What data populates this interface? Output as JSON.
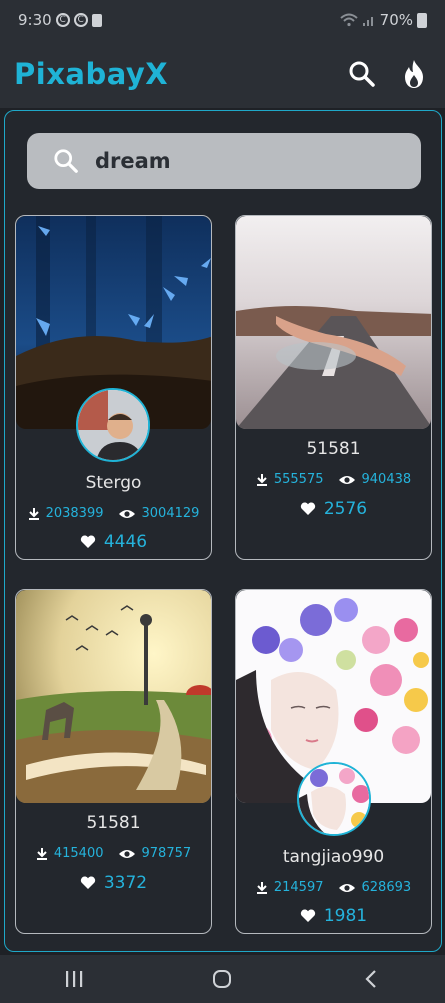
{
  "status": {
    "time": "9:30",
    "battery": "70%"
  },
  "app": {
    "title": "PixabayX"
  },
  "search": {
    "query": "dream"
  },
  "cards": [
    {
      "name": "Stergo",
      "downloads": "2038399",
      "views": "3004129",
      "likes": "4446",
      "image_icon": "butterflies-image",
      "has_avatar": true
    },
    {
      "name": "51581",
      "downloads": "555575",
      "views": "940438",
      "likes": "2576",
      "image_icon": "swimmer-road-image",
      "has_avatar": false
    },
    {
      "name": "51581",
      "downloads": "415400",
      "views": "978757",
      "likes": "3372",
      "image_icon": "book-landscape-image",
      "has_avatar": false
    },
    {
      "name": "tangjiao990",
      "downloads": "214597",
      "views": "628693",
      "likes": "1981",
      "image_icon": "flower-girl-image",
      "has_avatar": true
    }
  ],
  "colors": {
    "accent": "#1fb3d6",
    "background": "#1e2126",
    "bar": "#2b2f35"
  },
  "icons": {
    "search": "search-icon",
    "fire": "fire-icon",
    "download": "download-icon",
    "views": "eye-icon",
    "likes": "heart-icon",
    "nav_recent": "recent-apps-icon",
    "nav_home": "home-icon",
    "nav_back": "back-icon"
  }
}
